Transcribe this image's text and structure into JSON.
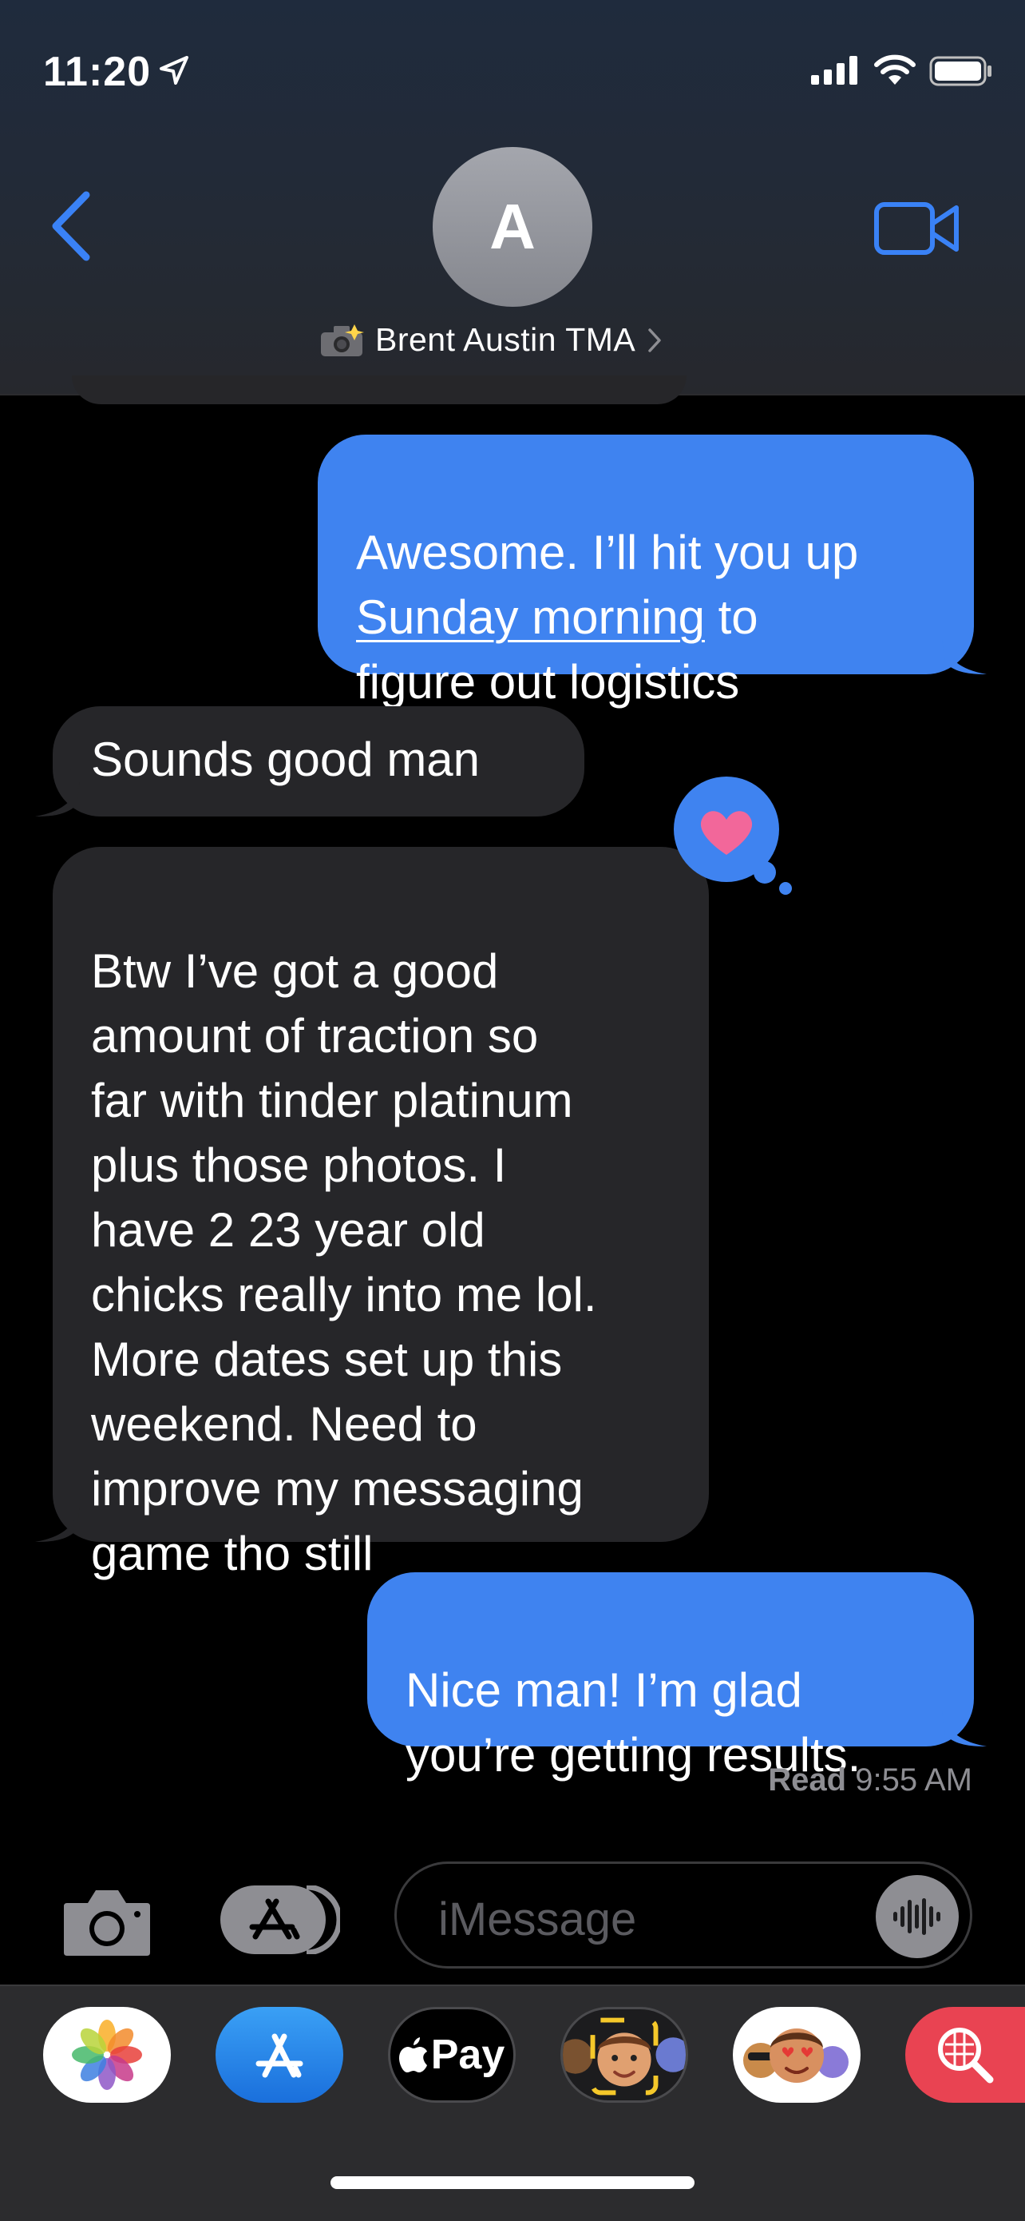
{
  "status_bar": {
    "time": "11:20",
    "icons": [
      "location-arrow-icon",
      "cellular-signal-icon",
      "wifi-icon",
      "battery-icon"
    ]
  },
  "nav": {
    "back_icon": "chevron-left-icon",
    "avatar_initial": "A",
    "contact_name": "Brent Austin TMA",
    "contact_prefix_icon": "camera-flash-emoji",
    "video_icon": "video-camera-icon"
  },
  "messages": [
    {
      "direction": "sent",
      "text_before": "Awesome. I’ll hit you up ",
      "link_text": "Sunday morning",
      "text_after": " to\nfigure out logistics"
    },
    {
      "direction": "received",
      "text": "Sounds good man"
    },
    {
      "direction": "received",
      "text": "Btw I’ve got a good\namount of traction so\nfar with tinder platinum\nplus those photos. I\nhave 2 23 year old\nchicks really into me lol.\nMore dates set up this\nweekend. Need to\nimprove my messaging\ngame tho still",
      "tapback": "heart"
    },
    {
      "direction": "sent",
      "text": "Nice man! I’m glad\nyou’re getting results."
    }
  ],
  "read_receipt": {
    "label": "Read",
    "time": "9:55 AM"
  },
  "composer": {
    "placeholder": "iMessage",
    "camera_icon": "camera-icon",
    "apps_icon": "app-store-icon",
    "audio_icon": "waveform-icon"
  },
  "app_drawer": {
    "apps": [
      "Photos",
      "App Store",
      "Apple Pay",
      "Memoji",
      "Memoji Stickers",
      "Search Images"
    ],
    "pay_label": "Pay"
  },
  "colors": {
    "sent_bubble": "#3f83f0",
    "received_bubble": "#262629",
    "accent": "#3a82f6"
  }
}
